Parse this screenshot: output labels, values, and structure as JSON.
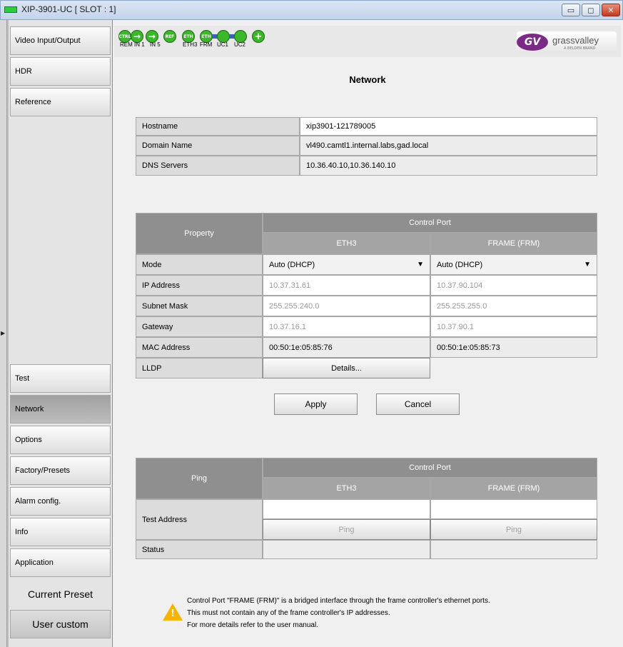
{
  "window": {
    "title": "XIP-3901-UC [ SLOT : 1]",
    "minimize": "▭",
    "maximize": "◻",
    "close": "✕"
  },
  "sidebar": {
    "items": [
      {
        "label": "Video Input/Output"
      },
      {
        "label": "HDR"
      },
      {
        "label": "Reference"
      },
      {
        "label": "Test"
      },
      {
        "label": "Network"
      },
      {
        "label": "Options"
      },
      {
        "label": "Factory/Presets"
      },
      {
        "label": "Alarm config."
      },
      {
        "label": "Info"
      },
      {
        "label": "Application"
      }
    ],
    "current_preset": "Current Preset",
    "user_custom": "User custom",
    "collapse_arrow": "▶"
  },
  "status": {
    "indicators": [
      {
        "icon": "CTRL",
        "label": "REM"
      },
      {
        "icon": "→",
        "label": "IN 1"
      },
      {
        "icon": "→",
        "label": "IN 5"
      },
      {
        "icon": "REF",
        "label": ""
      },
      {
        "icon": "ETH",
        "label": "ETH3"
      },
      {
        "icon": "ETH",
        "label": "FRM"
      },
      {
        "icon": "",
        "label": "UC1"
      },
      {
        "icon": "",
        "label": "UC2"
      },
      {
        "icon": "+",
        "label": ""
      }
    ],
    "colors": {
      "ok": "#3cb62a",
      "link": "#3b5ec8"
    }
  },
  "logo": {
    "mark": "GV",
    "text": "grassvalley",
    "sub": "A BELDEN BRAND"
  },
  "page_title": "Network",
  "host": {
    "hostname_label": "Hostname",
    "hostname_value": "xip3901-121789005",
    "domain_label": "Domain Name",
    "domain_value": "vl490.camtl1.internal.labs,gad.local",
    "dns_label": "DNS Servers",
    "dns_value": "10.36.40.10,10.36.140.10"
  },
  "ports": {
    "property_header": "Property",
    "control_port_header": "Control Port",
    "eth3_header": "ETH3",
    "frm_header": "FRAME (FRM)",
    "mode_label": "Mode",
    "mode_eth3": "Auto (DHCP)",
    "mode_frm": "Auto (DHCP)",
    "ip_label": "IP Address",
    "ip_eth3": "10.37.31.61",
    "ip_frm": "10.37.90.104",
    "subnet_label": "Subnet Mask",
    "subnet_eth3": "255.255.240.0",
    "subnet_frm": "255.255.255.0",
    "gateway_label": "Gateway",
    "gateway_eth3": "10.37.16.1",
    "gateway_frm": "10.37.90.1",
    "mac_label": "MAC Address",
    "mac_eth3": "00:50:1e:05:85:76",
    "mac_frm": "00:50:1e:05:85:73",
    "lldp_label": "LLDP",
    "details_button": "Details..."
  },
  "actions": {
    "apply": "Apply",
    "cancel": "Cancel"
  },
  "ping": {
    "header": "Ping",
    "control_port_header": "Control Port",
    "eth3_header": "ETH3",
    "frm_header": "FRAME (FRM)",
    "test_address_label": "Test Address",
    "test_eth3": "",
    "test_frm": "",
    "ping_eth3": "Ping",
    "ping_frm": "Ping",
    "status_label": "Status",
    "status_eth3": "",
    "status_frm": ""
  },
  "note": {
    "line1": "Control Port \"FRAME (FRM)\" is a bridged interface through the frame controller's ethernet ports.",
    "line2": "This must not contain any of the frame controller's IP addresses.",
    "line3": "For more details refer to the user manual.",
    "icon_mark": "!"
  }
}
